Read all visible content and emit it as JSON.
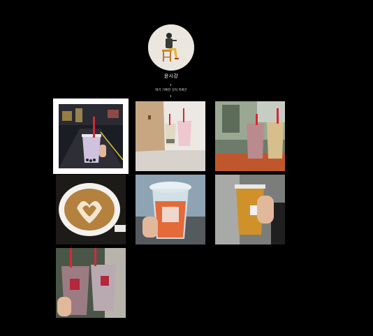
{
  "profile": {
    "username": "윤시강",
    "bio": "여기 기록한 것처 목록은"
  },
  "grid": {
    "posts": [
      {
        "icon": "bubble-tea-night-street-photo",
        "selected": true
      },
      {
        "icon": "two-bubble-teas-with-paper-bag-photo",
        "selected": false
      },
      {
        "icon": "two-drinks-on-window-ledge-photo",
        "selected": false
      },
      {
        "icon": "latte-art-cup-photo",
        "selected": false
      },
      {
        "icon": "hand-holding-drink-photo",
        "selected": false
      },
      {
        "icon": "hand-holding-tea-photo",
        "selected": false
      },
      {
        "icon": "two-milk-teas-held-photo",
        "selected": false
      }
    ]
  },
  "colors": {
    "background": "#000000",
    "straw_red": "#d42a37",
    "selection_border": "#ffffff"
  }
}
